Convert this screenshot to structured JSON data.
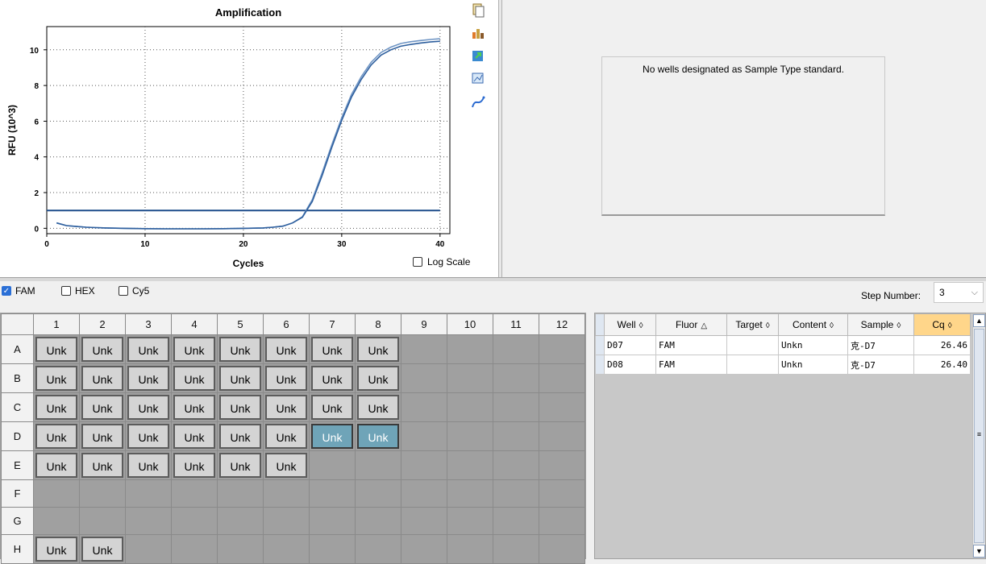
{
  "chart": {
    "title": "Amplification",
    "xlabel": "Cycles",
    "ylabel": "RFU (10^3)",
    "log_scale_label": "Log Scale",
    "log_scale_checked": false
  },
  "chart_data": {
    "type": "line",
    "title": "Amplification",
    "xlabel": "Cycles",
    "ylabel": "RFU (10^3)",
    "xlim": [
      0,
      41
    ],
    "ylim": [
      -0.3,
      11.3
    ],
    "xticks": [
      0,
      10,
      20,
      30,
      40
    ],
    "yticks": [
      0,
      2,
      4,
      6,
      8,
      10
    ],
    "grid": true,
    "threshold": 1.0,
    "series": [
      {
        "x": [
          1,
          2,
          3,
          4,
          5,
          6,
          8,
          10,
          12,
          14,
          16,
          18,
          20,
          22,
          23,
          24,
          25,
          26,
          27,
          28,
          29,
          30,
          31,
          32,
          33,
          34,
          35,
          36,
          37,
          38,
          39,
          40
        ],
        "y": [
          0.3,
          0.15,
          0.1,
          0.06,
          0.04,
          0.02,
          0.0,
          -0.02,
          -0.03,
          -0.03,
          -0.03,
          -0.02,
          0.0,
          0.02,
          0.06,
          0.12,
          0.3,
          0.65,
          1.6,
          3.1,
          4.7,
          6.2,
          7.5,
          8.5,
          9.3,
          9.85,
          10.15,
          10.35,
          10.45,
          10.52,
          10.58,
          10.62
        ]
      },
      {
        "x": [
          1,
          2,
          3,
          4,
          5,
          6,
          8,
          10,
          12,
          14,
          16,
          18,
          20,
          22,
          23,
          24,
          25,
          26,
          27,
          28,
          29,
          30,
          31,
          32,
          33,
          34,
          35,
          36,
          37,
          38,
          39,
          40
        ],
        "y": [
          0.3,
          0.15,
          0.1,
          0.06,
          0.04,
          0.02,
          0.0,
          -0.02,
          -0.03,
          -0.03,
          -0.03,
          -0.02,
          0.0,
          0.02,
          0.06,
          0.12,
          0.3,
          0.62,
          1.5,
          2.95,
          4.55,
          6.05,
          7.35,
          8.35,
          9.15,
          9.7,
          10.0,
          10.2,
          10.3,
          10.38,
          10.44,
          10.48
        ]
      }
    ]
  },
  "standard_panel": {
    "message": "No wells designated as Sample Type standard."
  },
  "fluors": [
    {
      "label": "FAM",
      "checked": true
    },
    {
      "label": "HEX",
      "checked": false
    },
    {
      "label": "Cy5",
      "checked": false
    }
  ],
  "step": {
    "label": "Step Number:",
    "value": "3"
  },
  "plate": {
    "columns": [
      "1",
      "2",
      "3",
      "4",
      "5",
      "6",
      "7",
      "8",
      "9",
      "10",
      "11",
      "12"
    ],
    "rows": [
      {
        "label": "A",
        "wells": [
          "Unk",
          "Unk",
          "Unk",
          "Unk",
          "Unk",
          "Unk",
          "Unk",
          "Unk",
          "",
          "",
          "",
          ""
        ]
      },
      {
        "label": "B",
        "wells": [
          "Unk",
          "Unk",
          "Unk",
          "Unk",
          "Unk",
          "Unk",
          "Unk",
          "Unk",
          "",
          "",
          "",
          ""
        ]
      },
      {
        "label": "C",
        "wells": [
          "Unk",
          "Unk",
          "Unk",
          "Unk",
          "Unk",
          "Unk",
          "Unk",
          "Unk",
          "",
          "",
          "",
          ""
        ]
      },
      {
        "label": "D",
        "wells": [
          "Unk",
          "Unk",
          "Unk",
          "Unk",
          "Unk",
          "Unk",
          "Unk*",
          "Unk*",
          "",
          "",
          "",
          ""
        ]
      },
      {
        "label": "E",
        "wells": [
          "Unk",
          "Unk",
          "Unk",
          "Unk",
          "Unk",
          "Unk",
          "",
          "",
          "",
          "",
          "",
          ""
        ]
      },
      {
        "label": "F",
        "wells": [
          "",
          "",
          "",
          "",
          "",
          "",
          "",
          "",
          "",
          "",
          "",
          ""
        ]
      },
      {
        "label": "G",
        "wells": [
          "",
          "",
          "",
          "",
          "",
          "",
          "",
          "",
          "",
          "",
          "",
          ""
        ]
      },
      {
        "label": "H",
        "wells": [
          "Unk",
          "Unk",
          "",
          "",
          "",
          "",
          "",
          "",
          "",
          "",
          "",
          ""
        ]
      }
    ]
  },
  "results": {
    "headers": [
      "Well",
      "Fluor",
      "Target",
      "Content",
      "Sample",
      "Cq"
    ],
    "sort_glyphs": [
      "◊",
      "△",
      "◊",
      "◊",
      "◊",
      "◊"
    ],
    "rows": [
      [
        "D07",
        "FAM",
        "",
        "Unkn",
        "克-D7",
        "26.46"
      ],
      [
        "D08",
        "FAM",
        "",
        "Unkn",
        "克-D7",
        "26.40"
      ]
    ]
  }
}
